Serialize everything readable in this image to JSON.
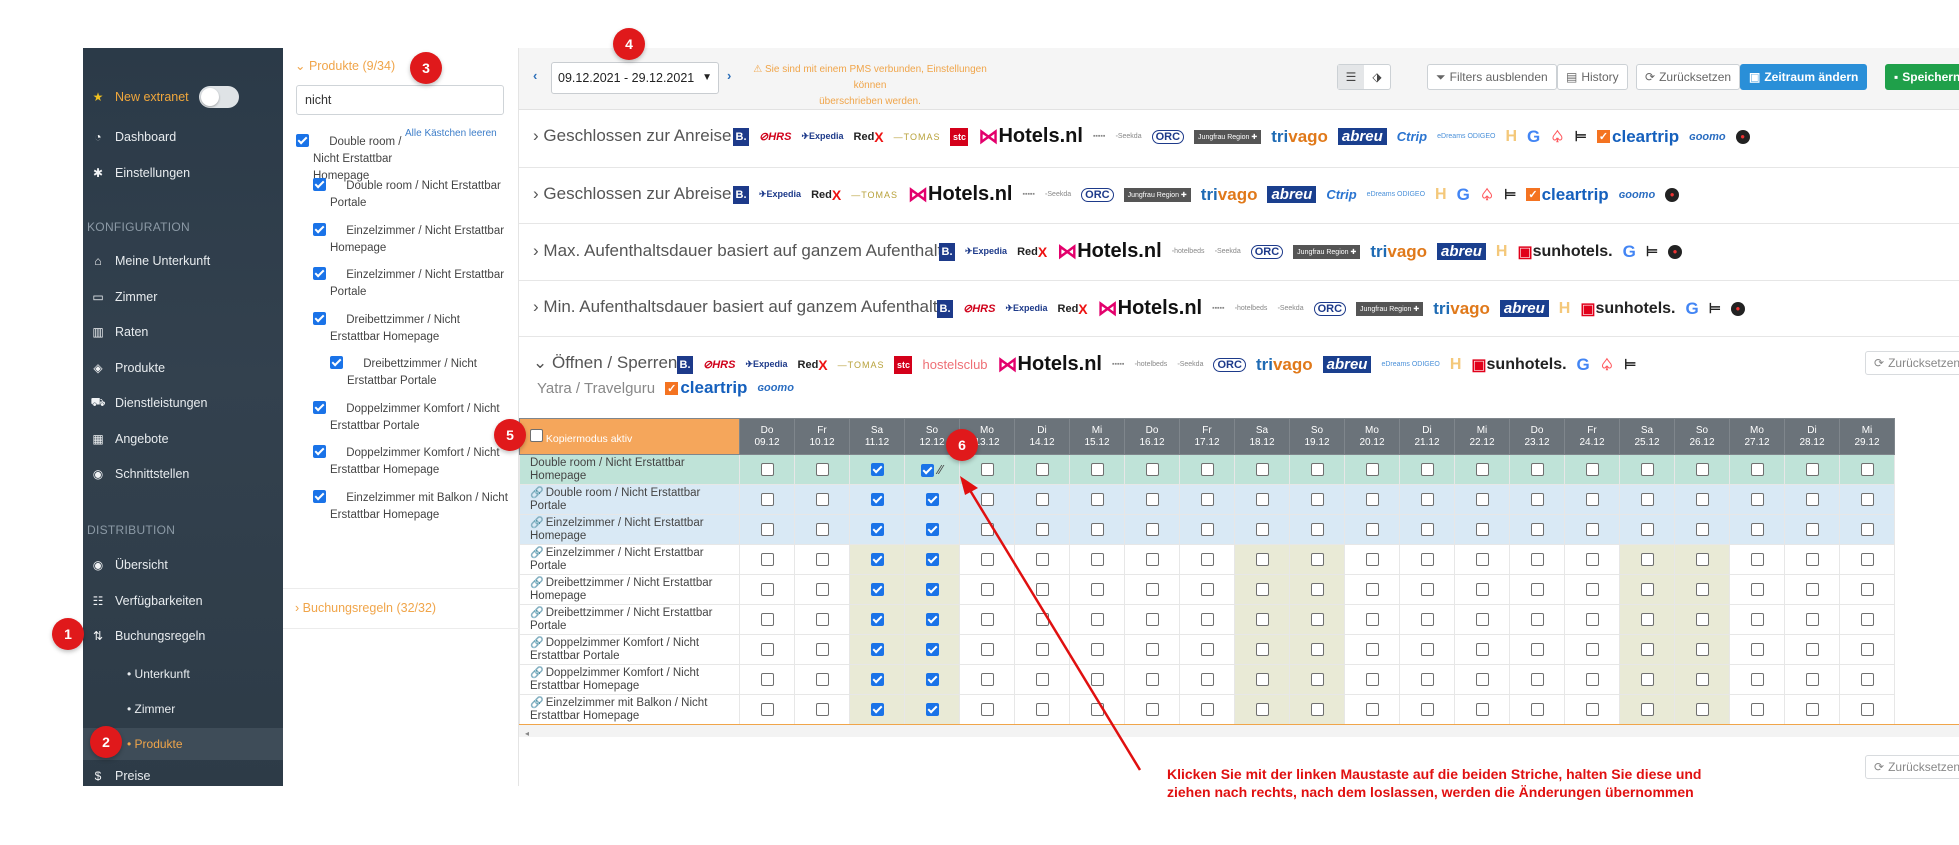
{
  "sidebar": {
    "new_extranet": "New extranet",
    "items": [
      {
        "label": "Dashboard",
        "icon": "dashboard-icon"
      },
      {
        "label": "Einstellungen",
        "icon": "gear-icon"
      }
    ],
    "section_konfiguration": "KONFIGURATION",
    "konfig_items": [
      {
        "label": "Meine Unterkunft",
        "icon": "home-icon"
      },
      {
        "label": "Zimmer",
        "icon": "bed-icon"
      },
      {
        "label": "Raten",
        "icon": "rates-icon"
      },
      {
        "label": "Produkte",
        "icon": "tags-icon"
      },
      {
        "label": "Dienstleistungen",
        "icon": "cart-icon"
      },
      {
        "label": "Angebote",
        "icon": "gift-icon"
      },
      {
        "label": "Schnittstellen",
        "icon": "globe-icon"
      }
    ],
    "section_distribution": "DISTRIBUTION",
    "dist_items": [
      {
        "label": "Übersicht",
        "icon": "eye-icon"
      },
      {
        "label": "Verfügbarkeiten",
        "icon": "calendar-icon"
      },
      {
        "label": "Buchungsregeln",
        "icon": "sort-icon"
      }
    ],
    "sub_items": [
      "• Unterkunft",
      "• Zimmer",
      "• Produkte"
    ],
    "preise": "Preise"
  },
  "panel": {
    "title": "Produkte (9/34)",
    "search_value": "nicht",
    "alle_link": "Alle Kästchen leeren",
    "products": [
      "Double room / Nicht Erstattbar Homepage",
      "Double room / Nicht Erstattbar Portale",
      "Einzelzimmer / Nicht Erstattbar Homepage",
      "Einzelzimmer / Nicht Erstattbar Portale",
      "Dreibettzimmer / Nicht Erstattbar Homepage",
      "Dreibettzimmer / Nicht Erstattbar Portale",
      "Doppelzimmer Komfort / Nicht Erstattbar Portale",
      "Doppelzimmer Komfort / Nicht Erstattbar Homepage",
      "Einzelzimmer mit Balkon / Nicht Erstattbar Homepage"
    ],
    "footer": "Buchungsregeln (32/32)"
  },
  "toolbar": {
    "date_range": "09.12.2021 - 29.12.2021",
    "pms_warning_line1": "⚠ Sie sind mit einem PMS verbunden, Einstellungen können",
    "pms_warning_line2": "überschrieben werden.",
    "filters_label": "Filters ausblenden",
    "history_label": "History",
    "reset_label": "Zurücksetzen",
    "period_label": "Zeitraum ändern",
    "save_label": "Speichern"
  },
  "rules": [
    {
      "title": "Geschlossen zur Anreise",
      "expanded": false
    },
    {
      "title": "Geschlossen zur Abreise",
      "expanded": false
    },
    {
      "title": "Max. Aufenthaltsdauer basiert auf ganzem Aufenthalt",
      "expanded": false
    },
    {
      "title": "Min. Aufenthaltsdauer basiert auf ganzem Aufenthalt",
      "expanded": false
    },
    {
      "title": "Öffnen / Sperren",
      "expanded": true,
      "extra": "Yatra / Travelguru",
      "reset_label": "Zurücksetzen"
    }
  ],
  "grid": {
    "copy_mode_label": "Kopiermodus aktiv",
    "days": [
      {
        "wd": "Do",
        "d": "09.12"
      },
      {
        "wd": "Fr",
        "d": "10.12"
      },
      {
        "wd": "Sa",
        "d": "11.12"
      },
      {
        "wd": "So",
        "d": "12.12"
      },
      {
        "wd": "Mo",
        "d": "13.12"
      },
      {
        "wd": "Di",
        "d": "14.12"
      },
      {
        "wd": "Mi",
        "d": "15.12"
      },
      {
        "wd": "Do",
        "d": "16.12"
      },
      {
        "wd": "Fr",
        "d": "17.12"
      },
      {
        "wd": "Sa",
        "d": "18.12"
      },
      {
        "wd": "So",
        "d": "19.12"
      },
      {
        "wd": "Mo",
        "d": "20.12"
      },
      {
        "wd": "Di",
        "d": "21.12"
      },
      {
        "wd": "Mi",
        "d": "22.12"
      },
      {
        "wd": "Do",
        "d": "23.12"
      },
      {
        "wd": "Fr",
        "d": "24.12"
      },
      {
        "wd": "Sa",
        "d": "25.12"
      },
      {
        "wd": "So",
        "d": "26.12"
      },
      {
        "wd": "Mo",
        "d": "27.12"
      },
      {
        "wd": "Di",
        "d": "28.12"
      },
      {
        "wd": "Mi",
        "d": "29.12"
      }
    ],
    "rows": [
      {
        "label": "Double room / Nicht Erstattbar Homepage",
        "linked": false,
        "checked": [
          2,
          3
        ]
      },
      {
        "label": "Double room / Nicht Erstattbar Portale",
        "linked": true,
        "checked": [
          2,
          3
        ]
      },
      {
        "label": "Einzelzimmer / Nicht Erstattbar Homepage",
        "linked": true,
        "checked": [
          2,
          3
        ]
      },
      {
        "label": "Einzelzimmer / Nicht Erstattbar Portale",
        "linked": true,
        "checked": [
          2,
          3
        ]
      },
      {
        "label": "Dreibettzimmer / Nicht Erstattbar Homepage",
        "linked": true,
        "checked": [
          2,
          3
        ]
      },
      {
        "label": "Dreibettzimmer / Nicht Erstattbar Portale",
        "linked": true,
        "checked": [
          2,
          3
        ]
      },
      {
        "label": "Doppelzimmer Komfort / Nicht Erstattbar Portale",
        "linked": true,
        "checked": [
          2,
          3
        ]
      },
      {
        "label": "Doppelzimmer Komfort / Nicht Erstattbar Homepage",
        "linked": true,
        "checked": [
          2,
          3
        ]
      },
      {
        "label": "Einzelzimmer mit Balkon / Nicht Erstattbar Homepage",
        "linked": true,
        "checked": [
          2,
          3
        ]
      }
    ],
    "reset_label": "Zurücksetzen"
  },
  "annotations": {
    "badges": [
      "1",
      "2",
      "3",
      "4",
      "5",
      "6"
    ],
    "instruction_line1": "Klicken Sie mit der linken Maustaste auf die beiden Striche, halten Sie diese und",
    "instruction_line2": "ziehen nach rechts, nach dem loslassen, werden die Änderungen übernommen",
    "badge_color": "#e0191b",
    "instruction_color": "#e01010"
  },
  "colors": {
    "accent_orange": "#f0a54a",
    "sidebar_bg": "#2b3a48",
    "primary_blue": "#2a8fd8",
    "save_green": "#1fa04a",
    "highlight_row": "#bfe3d8",
    "linked_rows": "#d9e9f5",
    "weekend": "#e9ead6"
  }
}
